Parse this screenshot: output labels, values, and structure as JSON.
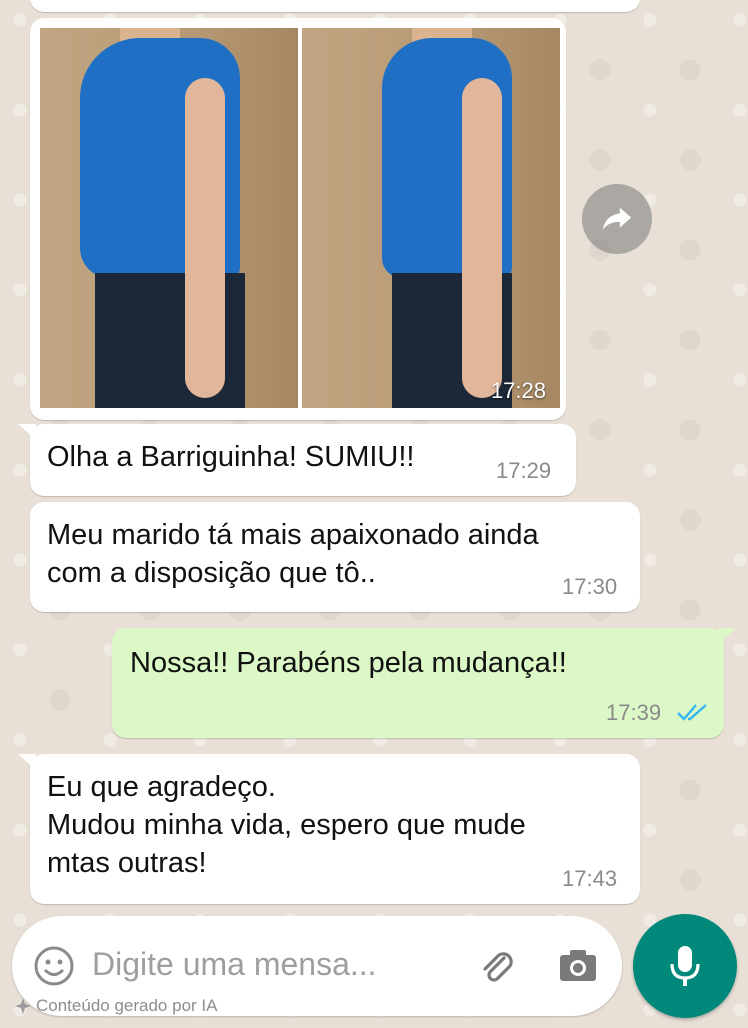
{
  "messages": [
    {
      "type": "image",
      "direction": "in",
      "time": "17:28"
    },
    {
      "type": "text",
      "direction": "in",
      "text": "Olha a Barriguinha! SUMIU!!",
      "time": "17:29"
    },
    {
      "type": "text",
      "direction": "in",
      "text": "Meu marido tá mais apaixonado ainda\ncom a disposição que tô..",
      "time": "17:30"
    },
    {
      "type": "text",
      "direction": "out",
      "text": "Nossa!! Parabéns pela mudança!!",
      "time": "17:39",
      "status_icon": "double-check-read-icon"
    },
    {
      "type": "text",
      "direction": "in",
      "text": "Eu que agradeço.\nMudou minha vida, espero que mude\nmtas outras!",
      "time": "17:43"
    }
  ],
  "input": {
    "placeholder": "Digite uma mensa..."
  },
  "footer_note": "Conteúdo gerado por IA",
  "icons": {
    "forward": "forward-arrow-icon",
    "emoji": "emoji-smiley-icon",
    "attach": "paperclip-icon",
    "camera": "camera-icon",
    "mic": "microphone-icon",
    "read_status": "double-check-read-icon"
  },
  "colors": {
    "incoming_bubble": "#ffffff",
    "outgoing_bubble": "#dcf8c6",
    "accent": "#00897b",
    "read_check": "#34b7f1",
    "wallpaper": "#e8e0d6"
  }
}
